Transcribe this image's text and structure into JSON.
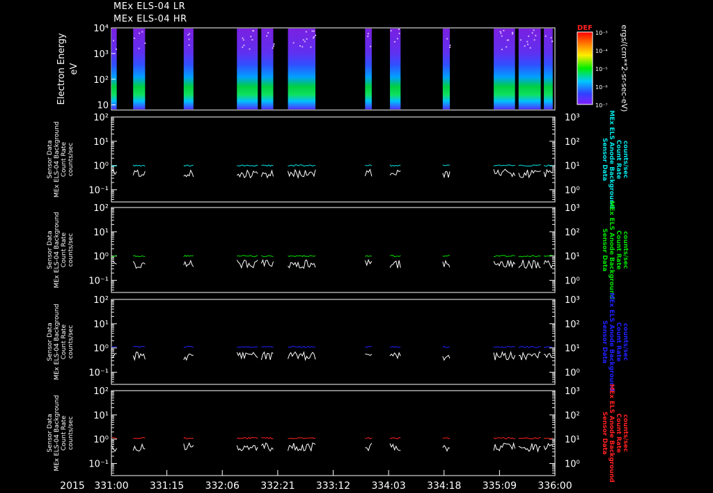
{
  "header": {
    "line1": "MEx ELS-04 LR",
    "line2": "MEx ELS-04 HR"
  },
  "colors": {
    "panel2_series": "#00e5e5",
    "panel3_series": "#00e000",
    "panel4_series": "#2020ff",
    "panel5_series": "#ff2020",
    "white_series": "#ffffff"
  },
  "chart_data": [
    {
      "type": "heatmap",
      "ylabel": "Electron Energy",
      "yunit": "eV",
      "yscale": "log",
      "yticks": [
        "10",
        "10²",
        "10³",
        "10⁴"
      ],
      "colorbar": {
        "title": "DEF",
        "unit": "ergs/(cm**2-sr-sec-eV)",
        "ticks": [
          "10⁻³",
          "10⁻⁴",
          "10⁻⁵",
          "10⁻⁶",
          "10⁻⁷"
        ]
      },
      "coverage_fraction_intervals": [
        [
          0.0,
          0.012
        ],
        [
          0.049,
          0.076
        ],
        [
          0.163,
          0.185
        ],
        [
          0.283,
          0.33
        ],
        [
          0.338,
          0.365
        ],
        [
          0.398,
          0.46
        ],
        [
          0.572,
          0.587
        ],
        [
          0.628,
          0.652
        ],
        [
          0.747,
          0.763
        ],
        [
          0.862,
          0.91
        ],
        [
          0.918,
          0.968
        ],
        [
          0.975,
          0.995
        ]
      ]
    },
    {
      "type": "line",
      "ylabel_left": [
        "Sensor Data",
        "MEx ELS-04 Background",
        "Count Rate",
        "counts/sec"
      ],
      "ylabel_right": [
        "Sensor Data",
        "MEx ELS Anode Background",
        "Count Rate",
        "counts/sec"
      ],
      "yscale": "log",
      "left_ticks": [
        "10⁻¹",
        "10⁰",
        "10¹",
        "10²"
      ],
      "right_ticks": [
        "10⁰",
        "10¹",
        "10²",
        "10³"
      ],
      "series": [
        {
          "color": "cyan",
          "level": 1.0
        },
        {
          "color": "white",
          "level": 0.7
        }
      ]
    },
    {
      "type": "line",
      "ylabel_left": [
        "Sensor Data",
        "MEx ELS-04 Background",
        "Count Rate",
        "counts/sec"
      ],
      "ylabel_right": [
        "Sensor Data",
        "MEx ELS Anode Background",
        "Count Rate",
        "counts/sec"
      ],
      "yscale": "log",
      "left_ticks": [
        "10⁻¹",
        "10⁰",
        "10¹",
        "10²"
      ],
      "right_ticks": [
        "10⁰",
        "10¹",
        "10²",
        "10³"
      ],
      "series": [
        {
          "color": "green",
          "level": 1.0
        },
        {
          "color": "white",
          "level": 0.7
        }
      ]
    },
    {
      "type": "line",
      "ylabel_left": [
        "Sensor Data",
        "MEx ELS-04 Background",
        "Count Rate",
        "counts/sec"
      ],
      "ylabel_right": [
        "Sensor Data",
        "MEx ELS Anode Background",
        "Count Rate",
        "counts/sec"
      ],
      "yscale": "log",
      "left_ticks": [
        "10⁻¹",
        "10⁰",
        "10¹",
        "10²"
      ],
      "right_ticks": [
        "10⁰",
        "10¹",
        "10²",
        "10³"
      ],
      "series": [
        {
          "color": "blue",
          "level": 1.1
        },
        {
          "color": "white",
          "level": 0.7
        }
      ]
    },
    {
      "type": "line",
      "ylabel_left": [
        "Sensor Data",
        "MEx ELS-04 Background",
        "Count Rate",
        "counts/sec"
      ],
      "ylabel_right": [
        "Sensor Data",
        "MEx ELS Anode Background",
        "Count Rate",
        "counts/sec"
      ],
      "yscale": "log",
      "left_ticks": [
        "10⁻¹",
        "10⁰",
        "10¹",
        "10²"
      ],
      "right_ticks": [
        "10⁰",
        "10¹",
        "10²",
        "10³"
      ],
      "series": [
        {
          "color": "red",
          "level": 1.1
        },
        {
          "color": "white",
          "level": 0.7
        }
      ]
    }
  ],
  "xaxis": {
    "year_label": "2015",
    "tick_labels": [
      "331:00",
      "331:15",
      "332:06",
      "332:21",
      "333:12",
      "334:03",
      "334:18",
      "335:09",
      "336:00"
    ]
  }
}
